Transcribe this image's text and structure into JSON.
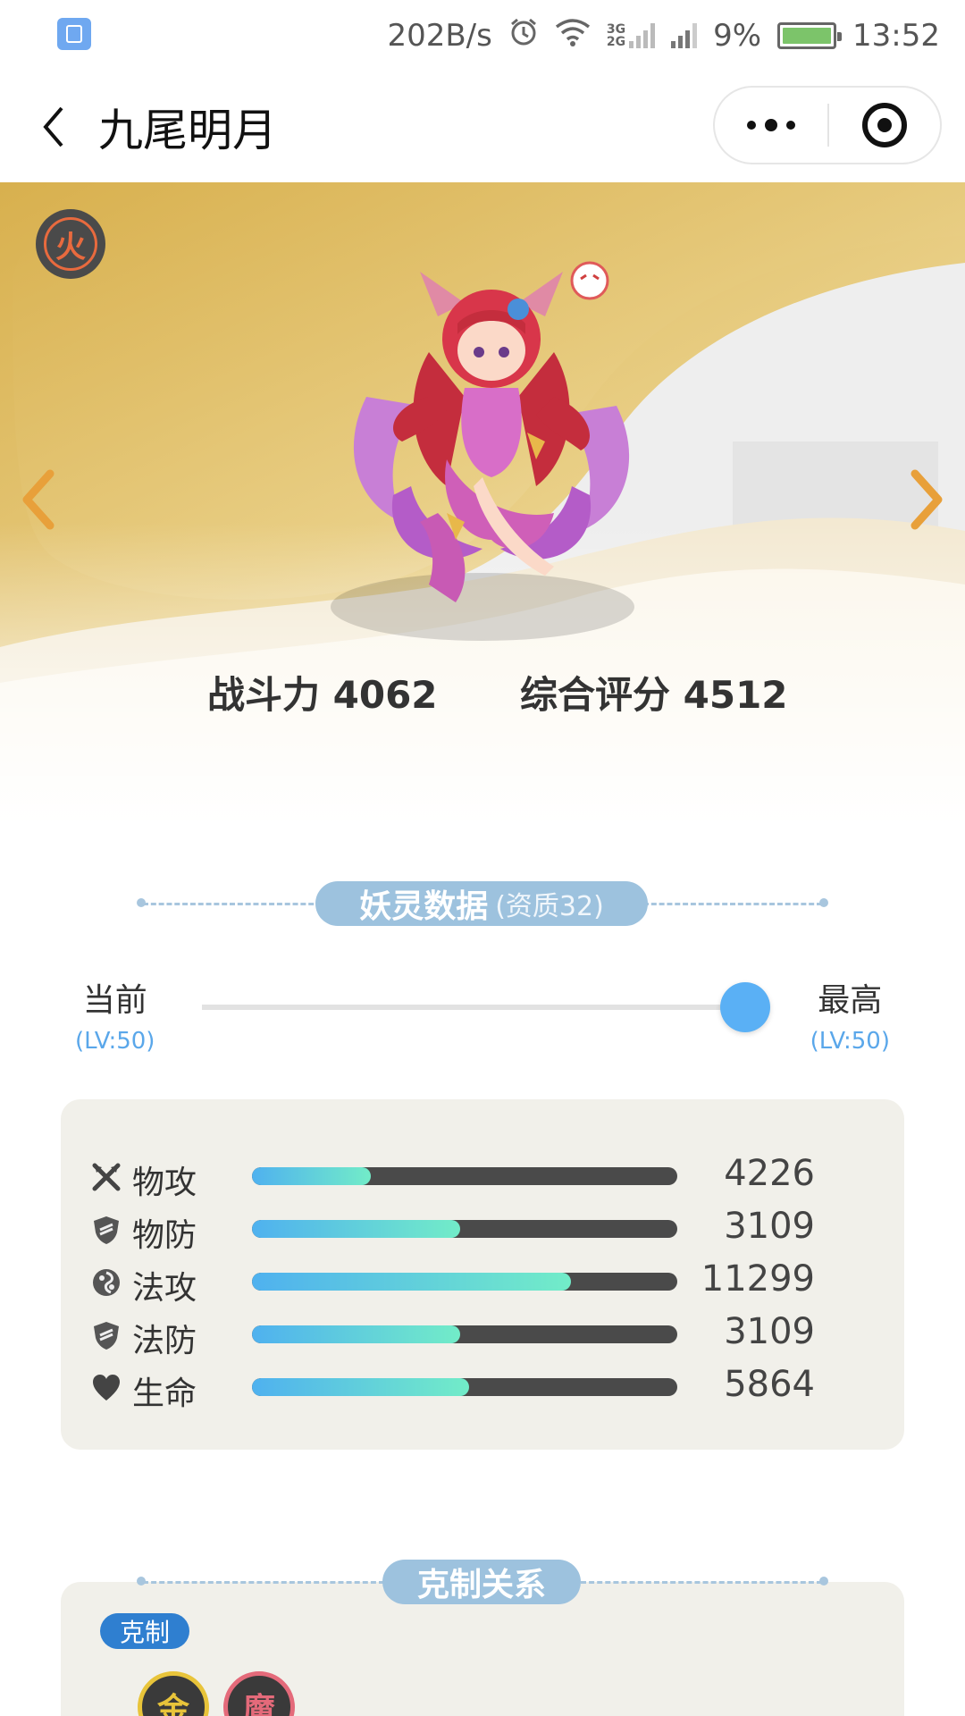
{
  "status_bar": {
    "net_speed": "202B/s",
    "network_type_top": "3G",
    "network_type_bottom": "2G",
    "battery_percent": "9%",
    "time": "13:52"
  },
  "header": {
    "title": "九尾明月"
  },
  "hero": {
    "element": "火",
    "power_label": "战斗力",
    "power_value": "4062",
    "score_label": "综合评分",
    "score_value": "4512"
  },
  "spirit_section": {
    "title": "妖灵数据",
    "subtitle": "(资质32)"
  },
  "level": {
    "current_label": "当前",
    "current_value": "(LV:50)",
    "max_label": "最高",
    "max_value": "(LV:50)",
    "slider_fraction": 1.0
  },
  "stats": [
    {
      "icon": "crossed-swords-icon",
      "name": "物攻",
      "value": "4226",
      "fraction": 0.28
    },
    {
      "icon": "shield-icon",
      "name": "物防",
      "value": "3109",
      "fraction": 0.49
    },
    {
      "icon": "magic-swirl-icon",
      "name": "法攻",
      "value": "11299",
      "fraction": 0.75
    },
    {
      "icon": "shield-icon",
      "name": "法防",
      "value": "3109",
      "fraction": 0.49
    },
    {
      "icon": "heart-icon",
      "name": "生命",
      "value": "5864",
      "fraction": 0.51
    }
  ],
  "counter_section": {
    "title": "克制关系",
    "tag": "克制",
    "icons": [
      {
        "name": "gold-element-icon",
        "text": "金"
      },
      {
        "name": "demon-element-icon",
        "text": "魔"
      }
    ]
  },
  "colors": {
    "accent_blue": "#5ab0f5",
    "section_pill": "#9dc2de",
    "gold": "#d9b04a",
    "bar_start": "#4fb1ef",
    "bar_end": "#72ecc8"
  }
}
